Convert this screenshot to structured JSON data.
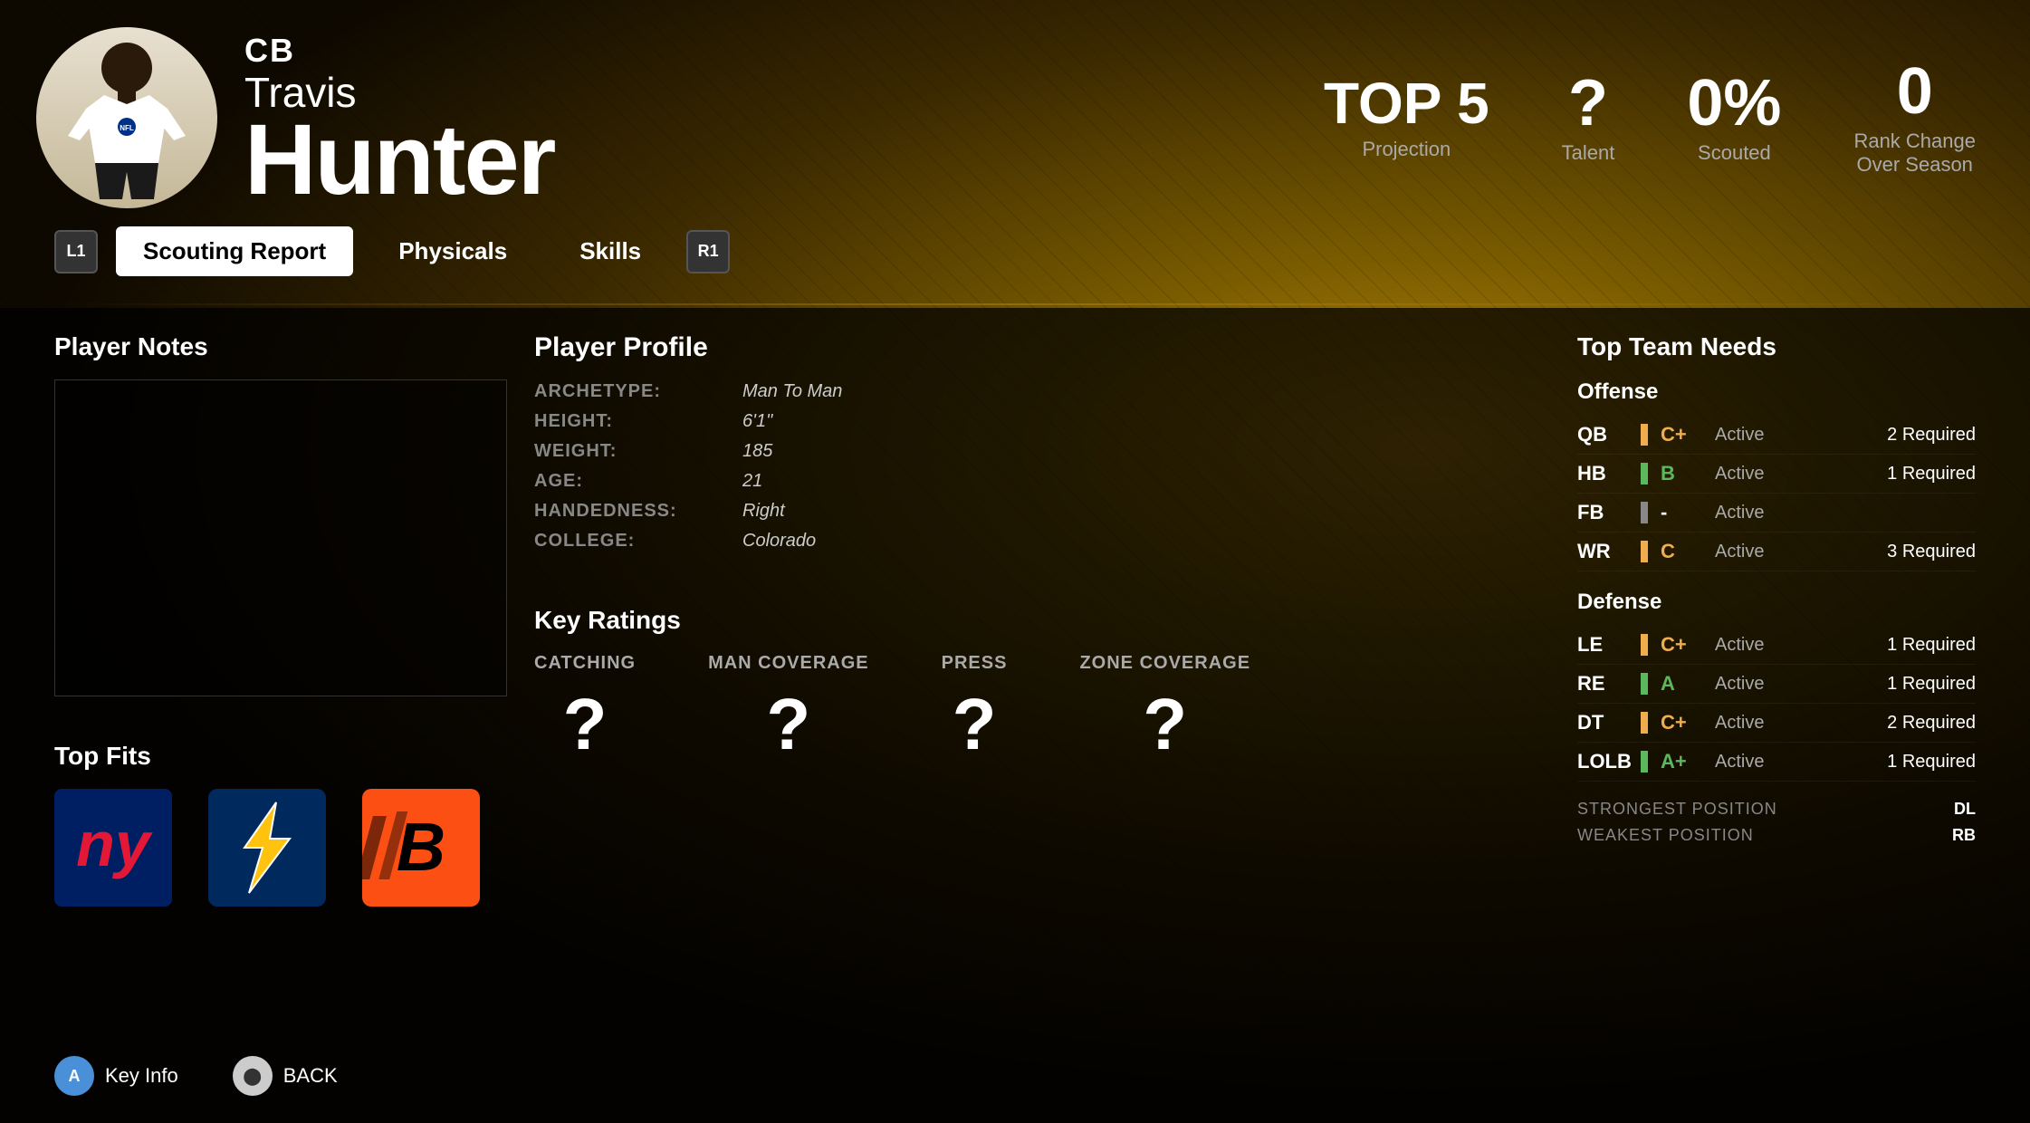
{
  "player": {
    "position": "CB",
    "first_name": "Travis",
    "last_name": "Hunter"
  },
  "header_stats": {
    "projection_label": "TOP 5",
    "projection_sublabel": "Projection",
    "talent_value": "?",
    "talent_label": "Talent",
    "scouted_value": "0%",
    "scouted_label": "Scouted",
    "rank_change_value": "0",
    "rank_change_label": "Rank Change\nOver Season"
  },
  "nav": {
    "left_btn": "L1",
    "right_btn": "R1",
    "tabs": [
      {
        "label": "Scouting Report",
        "active": true
      },
      {
        "label": "Physicals",
        "active": false
      },
      {
        "label": "Skills",
        "active": false
      }
    ]
  },
  "player_notes": {
    "title": "Player Notes"
  },
  "player_profile": {
    "title": "Player Profile",
    "fields": [
      {
        "label": "ARCHETYPE:",
        "value": "Man To Man"
      },
      {
        "label": "HEIGHT:",
        "value": "6'1\""
      },
      {
        "label": "WEIGHT:",
        "value": "185"
      },
      {
        "label": "AGE:",
        "value": "21"
      },
      {
        "label": "HANDEDNESS:",
        "value": "Right"
      },
      {
        "label": "COLLEGE:",
        "value": "Colorado"
      }
    ]
  },
  "top_fits": {
    "title": "Top Fits",
    "teams": [
      {
        "abbr": "NYG",
        "name": "New York Giants"
      },
      {
        "abbr": "LAC",
        "name": "Los Angeles Chargers"
      },
      {
        "abbr": "CIN",
        "name": "Cincinnati Bengals"
      }
    ]
  },
  "key_ratings": {
    "title": "Key Ratings",
    "ratings": [
      {
        "label": "CATCHING",
        "value": "?"
      },
      {
        "label": "MAN COVERAGE",
        "value": "?"
      },
      {
        "label": "PRESS",
        "value": "?"
      },
      {
        "label": "ZONE COVERAGE",
        "value": "?"
      }
    ]
  },
  "top_team_needs": {
    "title": "Top Team Needs",
    "offense": {
      "label": "Offense",
      "rows": [
        {
          "pos": "QB",
          "grade": "C+",
          "grade_color": "yellow",
          "status": "Active",
          "required": "2 Required"
        },
        {
          "pos": "HB",
          "grade": "B",
          "grade_color": "green",
          "status": "Active",
          "required": "1 Required"
        },
        {
          "pos": "FB",
          "grade": "-",
          "grade_color": "gray",
          "status": "Active",
          "required": ""
        },
        {
          "pos": "WR",
          "grade": "C",
          "grade_color": "yellow",
          "status": "Active",
          "required": "3 Required"
        }
      ]
    },
    "defense": {
      "label": "Defense",
      "rows": [
        {
          "pos": "LE",
          "grade": "C+",
          "grade_color": "yellow",
          "status": "Active",
          "required": "1 Required"
        },
        {
          "pos": "RE",
          "grade": "A",
          "grade_color": "green",
          "status": "Active",
          "required": "1 Required"
        },
        {
          "pos": "DT",
          "grade": "C+",
          "grade_color": "yellow",
          "status": "Active",
          "required": "2 Required"
        },
        {
          "pos": "LOLB",
          "grade": "A+",
          "grade_color": "green",
          "status": "Active",
          "required": "1 Required"
        }
      ]
    },
    "strongest_position_label": "STRONGEST POSITION",
    "strongest_position_value": "DL",
    "weakest_position_label": "WEAKEST POSITION",
    "weakest_position_value": "RB"
  },
  "footer": {
    "key_info_label": "Key Info",
    "back_label": "BACK",
    "key_info_icon": "A",
    "back_icon": "B"
  }
}
